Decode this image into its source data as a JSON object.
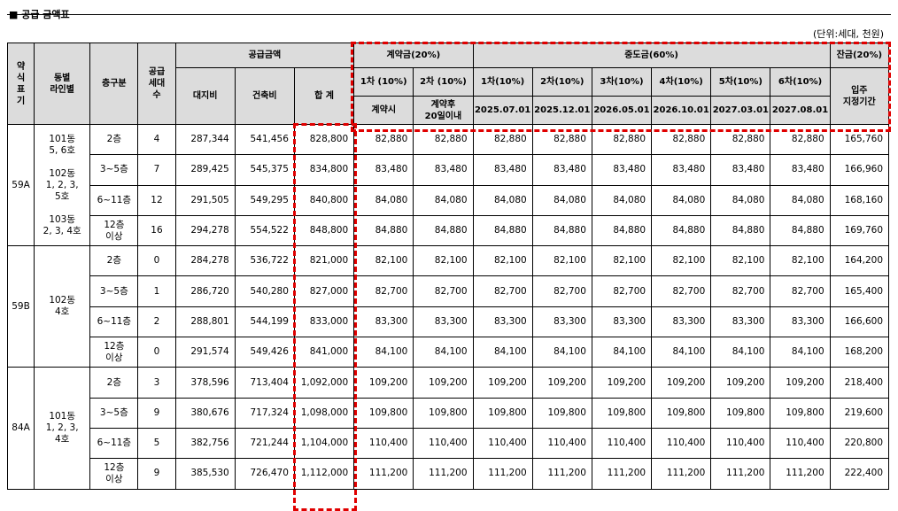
{
  "title": "■ 공급 금액표",
  "unit": "(단위:세대, 천원)",
  "header": {
    "c_type": "약\n식\n표\n기",
    "c_dong": "동별\n라인별",
    "c_floor": "층구분",
    "c_units": "공급\n세대\n수",
    "supply_price": "공급금액",
    "land": "대지비",
    "building": "건축비",
    "total": "합 계",
    "deposit": "계약금(20%)",
    "middle": "중도금(60%)",
    "balance": "잔금(20%)",
    "dep1": "1차 (10%)",
    "dep2": "2차 (10%)",
    "dep1_when": "계약시",
    "dep2_when": "계약후\n20일이내",
    "mid": [
      "1차(10%)",
      "2차(10%)",
      "3차(10%)",
      "4차(10%)",
      "5차(10%)",
      "6차(10%)"
    ],
    "mid_dates": [
      "2025.07.01",
      "2025.12.01",
      "2026.05.01",
      "2026.10.01",
      "2027.03.01",
      "2027.08.01"
    ],
    "bal_when": "입주\n지정기간"
  },
  "groups": [
    {
      "type": "59A",
      "dong": "101동\n5, 6호\n\n102동\n1, 2, 3,\n5호\n\n103동\n2, 3, 4호",
      "rows": [
        [
          "2층",
          "4",
          "287,344",
          "541,456",
          "828,800",
          "82,880",
          "82,880",
          "82,880",
          "82,880",
          "82,880",
          "82,880",
          "82,880",
          "82,880",
          "165,760"
        ],
        [
          "3~5층",
          "7",
          "289,425",
          "545,375",
          "834,800",
          "83,480",
          "83,480",
          "83,480",
          "83,480",
          "83,480",
          "83,480",
          "83,480",
          "83,480",
          "166,960"
        ],
        [
          "6~11층",
          "12",
          "291,505",
          "549,295",
          "840,800",
          "84,080",
          "84,080",
          "84,080",
          "84,080",
          "84,080",
          "84,080",
          "84,080",
          "84,080",
          "168,160"
        ],
        [
          "12층\n이상",
          "16",
          "294,278",
          "554,522",
          "848,800",
          "84,880",
          "84,880",
          "84,880",
          "84,880",
          "84,880",
          "84,880",
          "84,880",
          "84,880",
          "169,760"
        ]
      ]
    },
    {
      "type": "59B",
      "dong": "102동\n4호",
      "rows": [
        [
          "2층",
          "0",
          "284,278",
          "536,722",
          "821,000",
          "82,100",
          "82,100",
          "82,100",
          "82,100",
          "82,100",
          "82,100",
          "82,100",
          "82,100",
          "164,200"
        ],
        [
          "3~5층",
          "1",
          "286,720",
          "540,280",
          "827,000",
          "82,700",
          "82,700",
          "82,700",
          "82,700",
          "82,700",
          "82,700",
          "82,700",
          "82,700",
          "165,400"
        ],
        [
          "6~11층",
          "2",
          "288,801",
          "544,199",
          "833,000",
          "83,300",
          "83,300",
          "83,300",
          "83,300",
          "83,300",
          "83,300",
          "83,300",
          "83,300",
          "166,600"
        ],
        [
          "12층\n이상",
          "0",
          "291,574",
          "549,426",
          "841,000",
          "84,100",
          "84,100",
          "84,100",
          "84,100",
          "84,100",
          "84,100",
          "84,100",
          "84,100",
          "168,200"
        ]
      ]
    },
    {
      "type": "84A",
      "dong": "101동\n1, 2, 3,\n4호",
      "rows": [
        [
          "2층",
          "3",
          "378,596",
          "713,404",
          "1,092,000",
          "109,200",
          "109,200",
          "109,200",
          "109,200",
          "109,200",
          "109,200",
          "109,200",
          "109,200",
          "218,400"
        ],
        [
          "3~5층",
          "9",
          "380,676",
          "717,324",
          "1,098,000",
          "109,800",
          "109,800",
          "109,800",
          "109,800",
          "109,800",
          "109,800",
          "109,800",
          "109,800",
          "219,600"
        ],
        [
          "6~11층",
          "5",
          "382,756",
          "721,244",
          "1,104,000",
          "110,400",
          "110,400",
          "110,400",
          "110,400",
          "110,400",
          "110,400",
          "110,400",
          "110,400",
          "220,800"
        ],
        [
          "12층\n이상",
          "9",
          "385,530",
          "726,470",
          "1,112,000",
          "111,200",
          "111,200",
          "111,200",
          "111,200",
          "111,200",
          "111,200",
          "111,200",
          "111,200",
          "222,400"
        ]
      ]
    }
  ]
}
